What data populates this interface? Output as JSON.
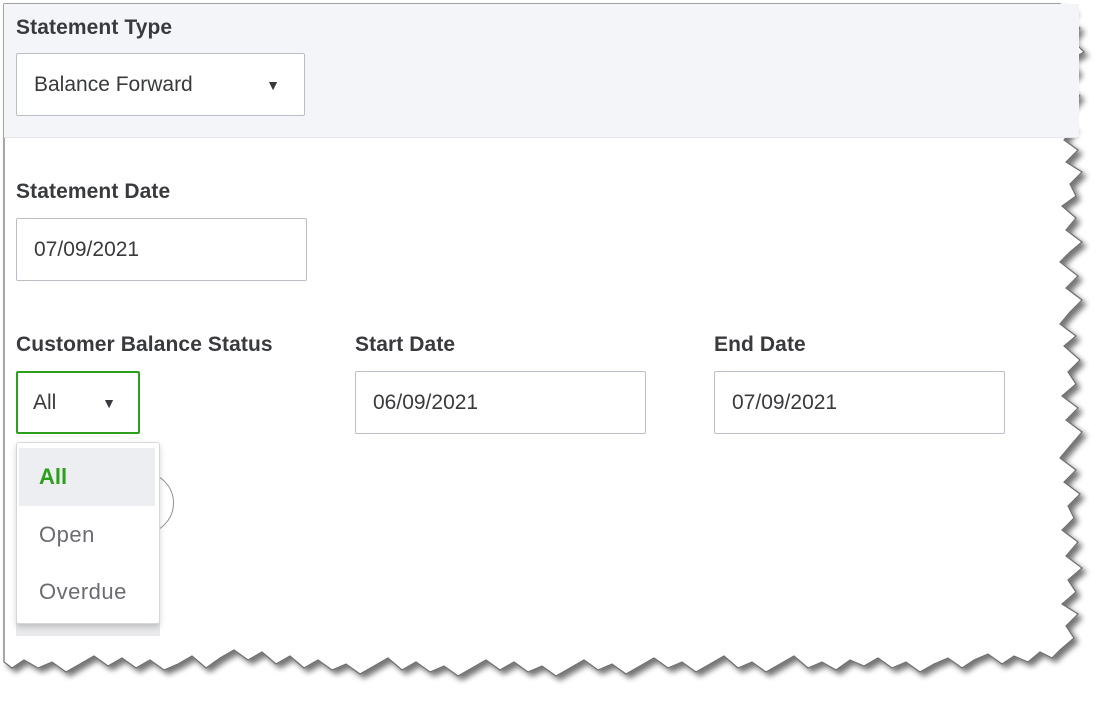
{
  "statement_type": {
    "label": "Statement Type",
    "value": "Balance Forward",
    "arrow": "▼"
  },
  "statement_date": {
    "label": "Statement Date",
    "value": "07/09/2021"
  },
  "customer_balance_status": {
    "label": "Customer Balance Status",
    "value": "All",
    "arrow": "▼",
    "options": [
      {
        "label": "All",
        "selected": true
      },
      {
        "label": "Open",
        "selected": false
      },
      {
        "label": "Overdue",
        "selected": false
      }
    ]
  },
  "start_date": {
    "label": "Start Date",
    "value": "06/09/2021"
  },
  "end_date": {
    "label": "End Date",
    "value": "07/09/2021"
  },
  "colors": {
    "accent": "#2ca01c",
    "text": "#393a3d",
    "band": "#f4f5f8",
    "border": "#babec5"
  }
}
